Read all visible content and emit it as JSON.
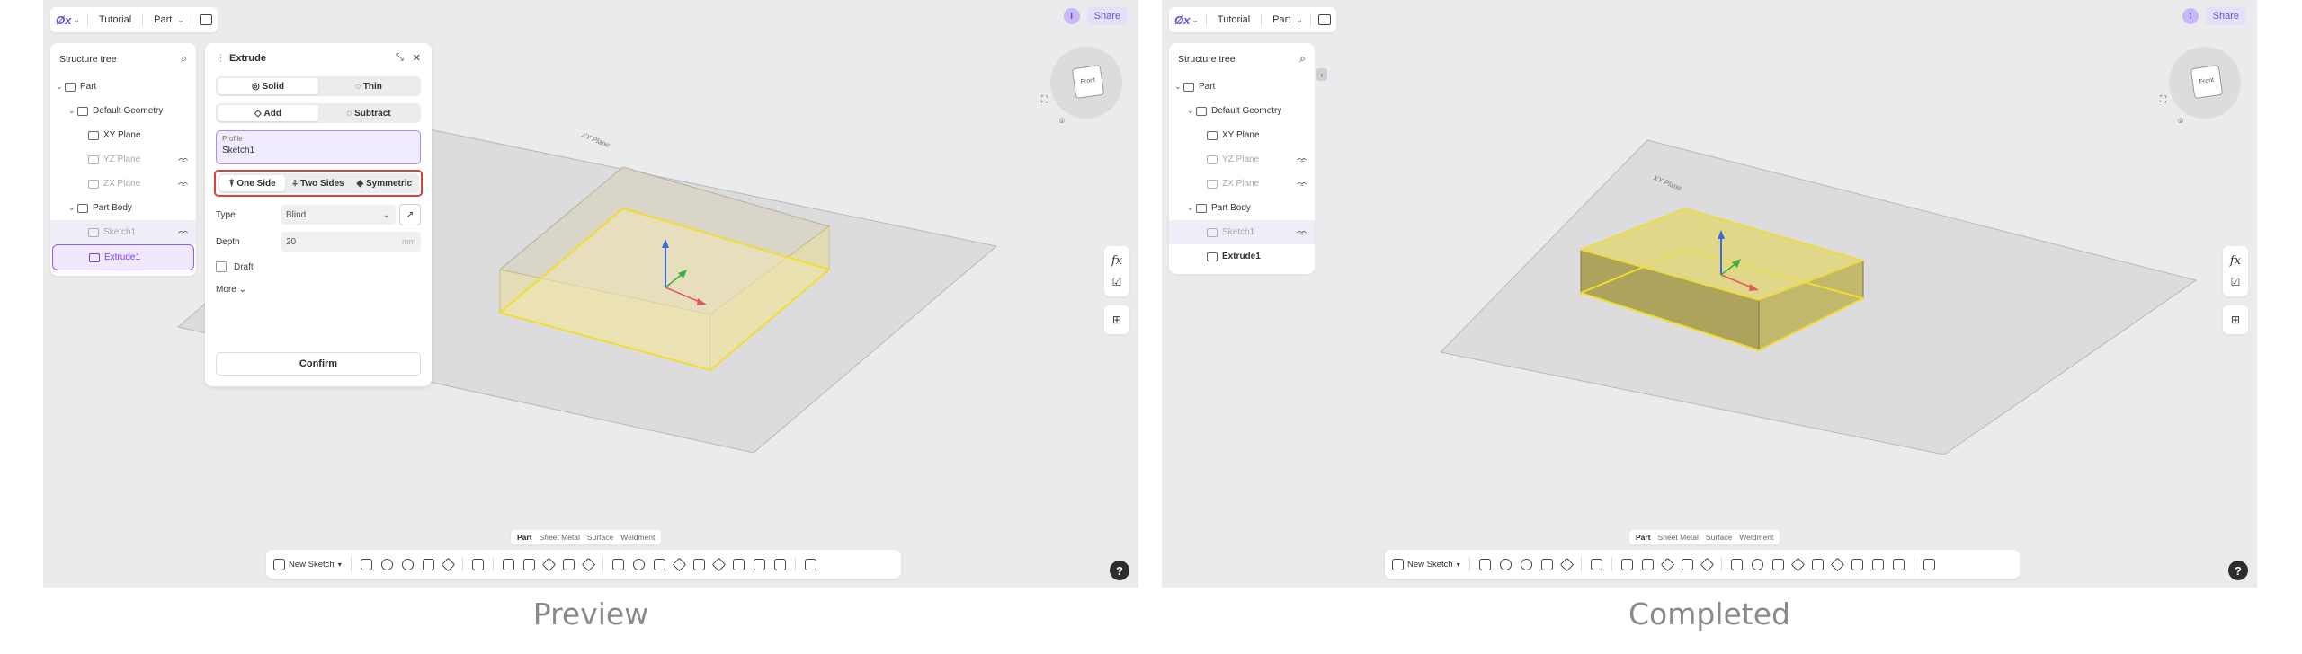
{
  "colors": {
    "accent": "#7c3aed",
    "highlight_box": "#e0403a",
    "body_yellow": "#f0e4a0",
    "edge_yellow": "#f5e13a"
  },
  "panels": [
    {
      "caption": "Preview",
      "header": {
        "logo": "Øx",
        "breadcrumb1": "Tutorial",
        "breadcrumb2": "Part",
        "avatar": "I",
        "share": "Share"
      },
      "tree": {
        "title": "Structure tree",
        "rows": [
          {
            "label": "Part"
          },
          {
            "label": "Default Geometry"
          },
          {
            "label": "XY Plane"
          },
          {
            "label": "YZ Plane"
          },
          {
            "label": "ZX Plane"
          },
          {
            "label": "Part Body"
          },
          {
            "label": "Sketch1"
          },
          {
            "label": "Extrude1"
          }
        ]
      },
      "dialog": {
        "title": "Extrude",
        "solid": "Solid",
        "thin": "Thin",
        "add": "Add",
        "subtract": "Subtract",
        "profile_label": "Profile",
        "profile_value": "Sketch1",
        "one_side": "One Side",
        "two_sides": "Two Sides",
        "symmetric": "Symmetric",
        "type_label": "Type",
        "type_value": "Blind",
        "depth_label": "Depth",
        "depth_value": "20",
        "depth_unit": "mm",
        "draft": "Draft",
        "more": "More",
        "confirm": "Confirm"
      },
      "plane_label": "XY Plane",
      "viewcube": {
        "face": "Front"
      },
      "tools": {
        "fx": "fx"
      },
      "bottom_tabs": [
        "Part",
        "Sheet Metal",
        "Surface",
        "Weldment"
      ],
      "new_sketch": "New Sketch",
      "help": "?"
    },
    {
      "caption": "Completed",
      "header": {
        "logo": "Øx",
        "breadcrumb1": "Tutorial",
        "breadcrumb2": "Part",
        "avatar": "I",
        "share": "Share"
      },
      "tree": {
        "title": "Structure tree",
        "rows": [
          {
            "label": "Part"
          },
          {
            "label": "Default Geometry"
          },
          {
            "label": "XY Plane"
          },
          {
            "label": "YZ Plane"
          },
          {
            "label": "ZX Plane"
          },
          {
            "label": "Part Body"
          },
          {
            "label": "Sketch1"
          },
          {
            "label": "Extrude1"
          }
        ]
      },
      "plane_label": "XY Plane",
      "viewcube": {
        "face": "Front"
      },
      "tools": {
        "fx": "fx"
      },
      "bottom_tabs": [
        "Part",
        "Sheet Metal",
        "Surface",
        "Weldment"
      ],
      "new_sketch": "New Sketch",
      "help": "?"
    }
  ]
}
